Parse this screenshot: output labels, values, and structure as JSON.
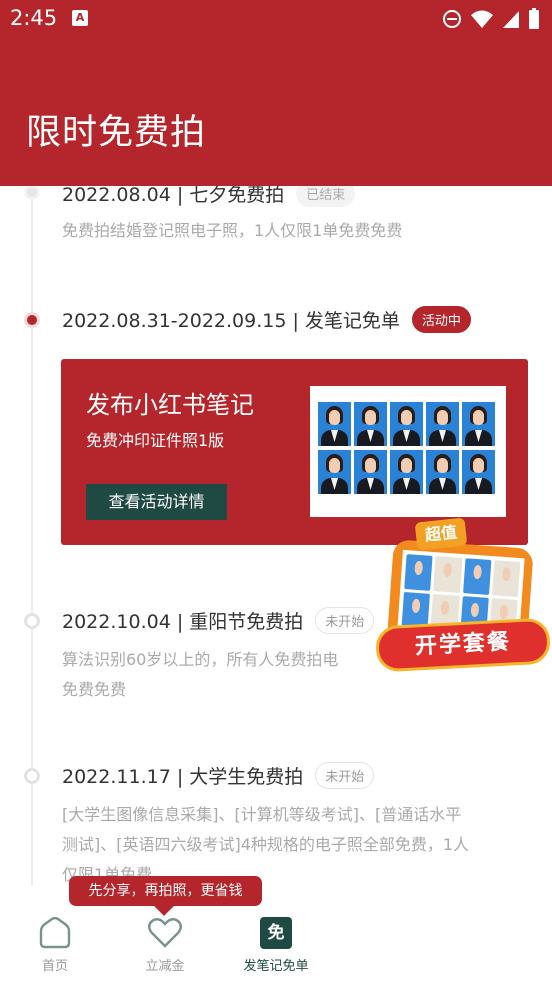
{
  "status_bar": {
    "time": "2:45",
    "notification_icon": "A"
  },
  "header": {
    "title": "限时免费拍"
  },
  "events": [
    {
      "title": "2022.08.04 | 七夕免费拍",
      "badge": "已结束",
      "desc": "免费拍结婚登记照电子照，1人仅限1单免费免费"
    },
    {
      "title": "2022.08.31-2022.09.15 | 发笔记免单",
      "badge": "活动中"
    },
    {
      "title": "2022.10.04 | 重阳节免费拍",
      "badge": "未开始",
      "desc_line1": "算法识别60岁以上的，所有人免费拍电",
      "desc_line2": "免费免费"
    },
    {
      "title": "2022.11.17 | 大学生免费拍",
      "badge": "未开始",
      "desc_line1": "[大学生图像信息采集]、[计算机等级考试]、[普通话水平",
      "desc_line2": "测试]、[英语四六级考试]4种规格的电子照全部免费，1人",
      "desc_line3": "仅限1单免费"
    }
  ],
  "promo": {
    "title": "发布小红书笔记",
    "subtitle": "免费冲印证件照1版",
    "button": "查看活动详情"
  },
  "sticker": {
    "tag": "超值",
    "label": "开学套餐"
  },
  "tooltip": "先分享，再拍照，更省钱",
  "nav": [
    {
      "label": "首页",
      "icon": "home-icon"
    },
    {
      "label": "立减金",
      "icon": "heart-icon"
    },
    {
      "label": "发笔记免单",
      "icon": "free-badge-icon",
      "glyph": "免",
      "active": true
    }
  ],
  "colors": {
    "brand_red": "#b4262b",
    "dark_green": "#1f4a43",
    "muted_text": "#aaaaaa"
  }
}
